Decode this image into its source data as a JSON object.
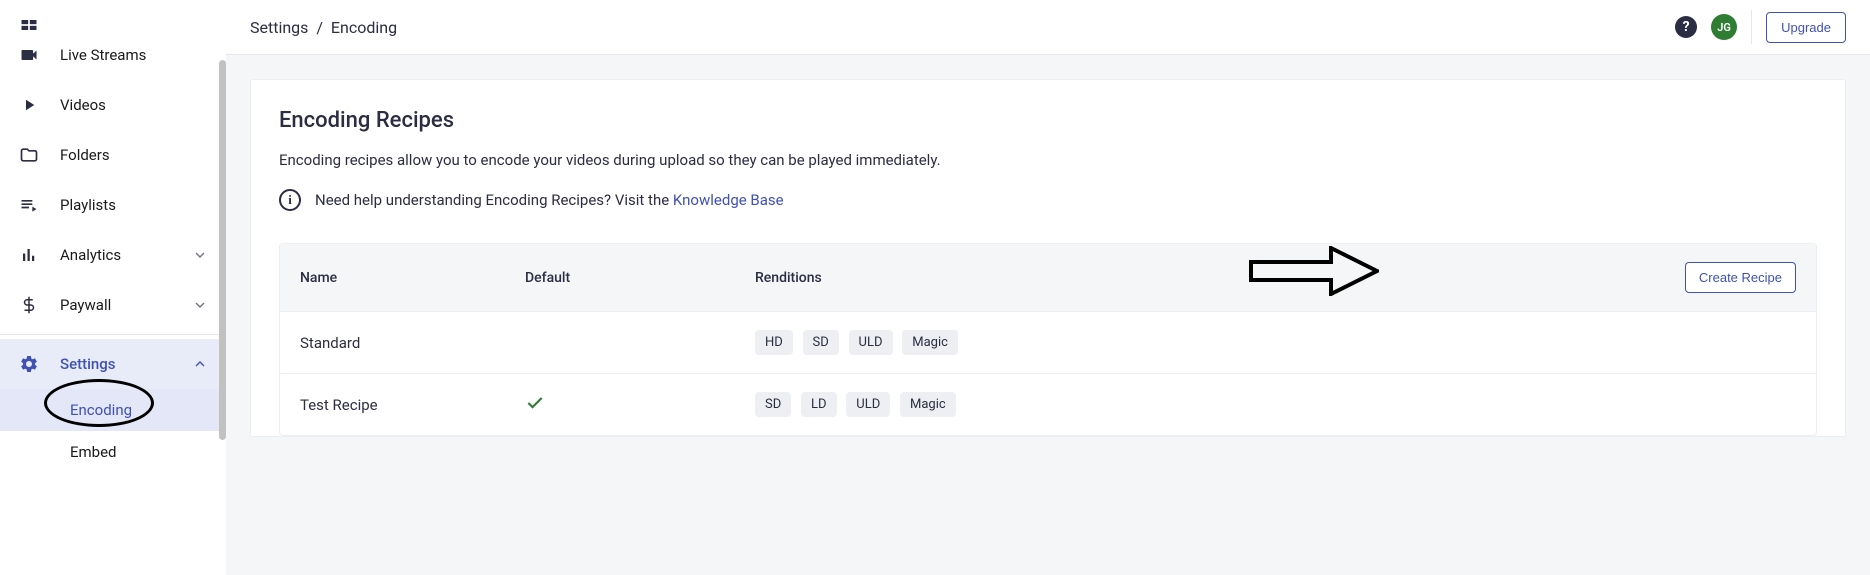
{
  "sidebar": {
    "items": [
      {
        "label": "Live Streams"
      },
      {
        "label": "Videos"
      },
      {
        "label": "Folders"
      },
      {
        "label": "Playlists"
      },
      {
        "label": "Analytics"
      },
      {
        "label": "Paywall"
      }
    ],
    "settings_label": "Settings",
    "sub": {
      "encoding": "Encoding",
      "embed": "Embed"
    }
  },
  "breadcrumb": {
    "parent": "Settings",
    "sep": "/",
    "current": "Encoding"
  },
  "topbar": {
    "avatar_initials": "JG",
    "upgrade": "Upgrade"
  },
  "page": {
    "title": "Encoding Recipes",
    "subtitle": "Encoding recipes allow you to encode your videos during upload so they can be played immediately.",
    "help_prefix": "Need help understanding Encoding Recipes? Visit the ",
    "help_link": "Knowledge Base"
  },
  "table": {
    "headers": {
      "name": "Name",
      "default": "Default",
      "renditions": "Renditions"
    },
    "create": "Create Recipe",
    "rows": [
      {
        "name": "Standard",
        "default": false,
        "renditions": [
          "HD",
          "SD",
          "ULD",
          "Magic"
        ]
      },
      {
        "name": "Test Recipe",
        "default": true,
        "renditions": [
          "SD",
          "LD",
          "ULD",
          "Magic"
        ]
      }
    ]
  }
}
